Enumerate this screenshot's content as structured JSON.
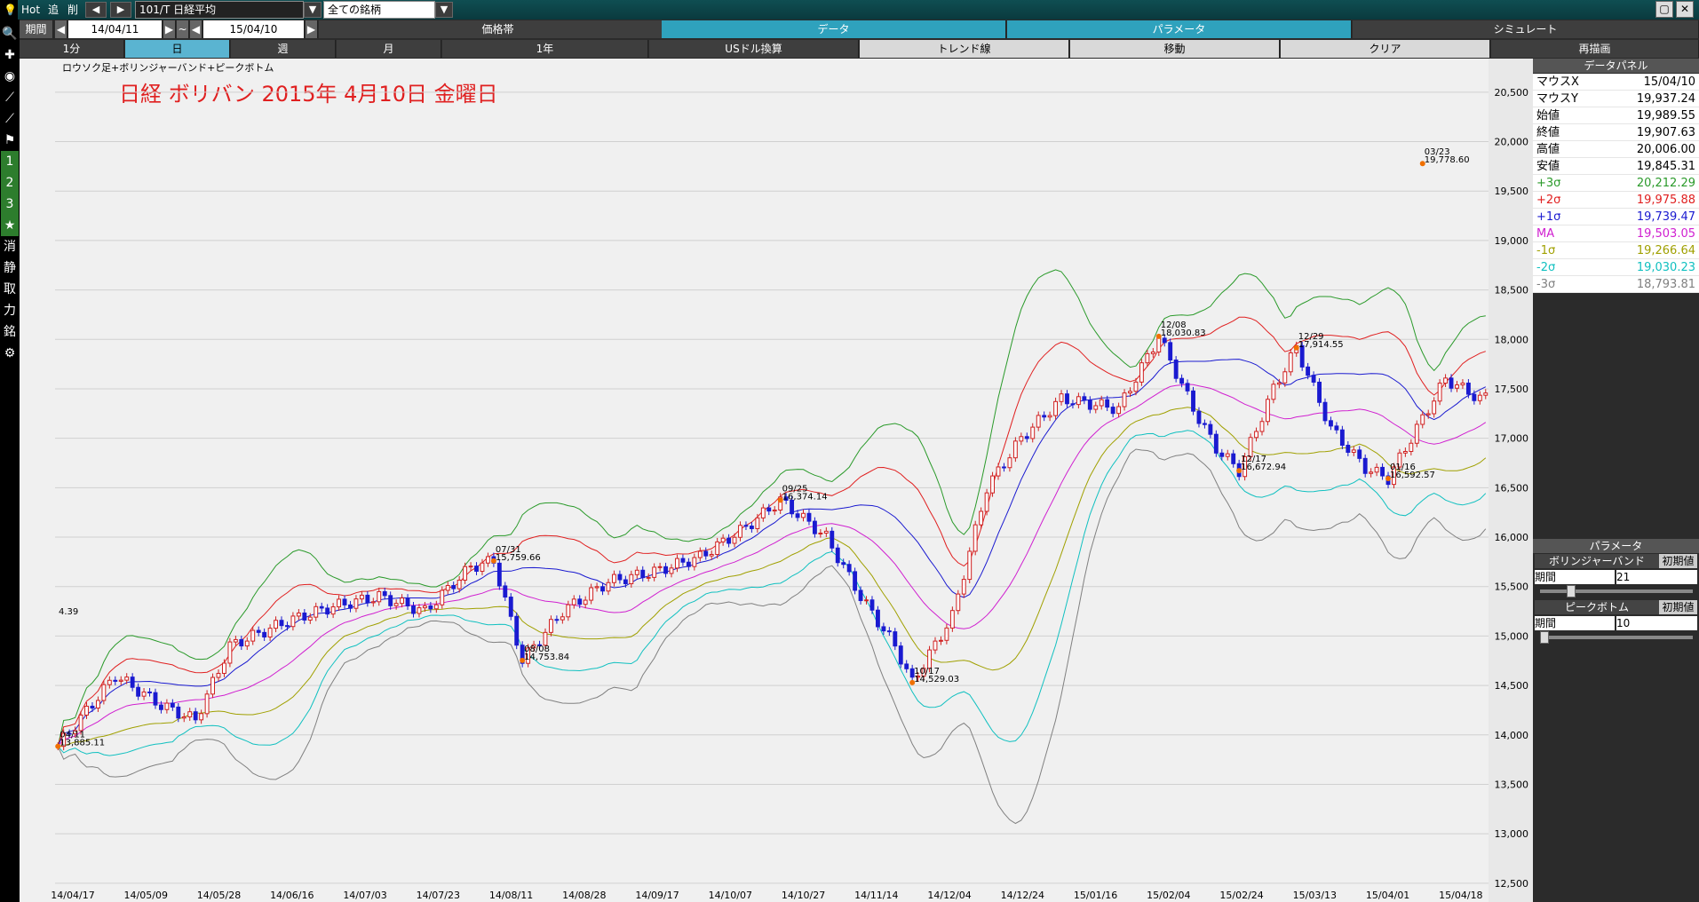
{
  "topbar": {
    "hot": "Hot",
    "add": "追",
    "del": "削",
    "symbol": "101/T 日経平均",
    "group": "全ての銘柄",
    "period_label": "期間",
    "date_from": "14/04/11",
    "tilde": "~",
    "date_to": "15/04/10",
    "minimize": "▢",
    "close": "✕"
  },
  "tabs_row1": [
    {
      "label": "価格帯"
    },
    {
      "label": "データ"
    },
    {
      "label": "パラメータ"
    },
    {
      "label": "シミュレート"
    }
  ],
  "tabs_row2": [
    {
      "label": "1分"
    },
    {
      "label": "日"
    },
    {
      "label": "週"
    },
    {
      "label": "月"
    },
    {
      "label": "1年"
    },
    {
      "label": "USドル換算"
    },
    {
      "label": "トレンド線"
    },
    {
      "label": "移動"
    },
    {
      "label": "クリア"
    },
    {
      "label": "再描画"
    }
  ],
  "leftbar": {
    "items": [
      {
        "glyph": "🔍",
        "icon": "search-icon"
      },
      {
        "glyph": "✚",
        "icon": "crosshair-icon"
      },
      {
        "glyph": "◉",
        "icon": "camera-icon"
      },
      {
        "glyph": "⟋",
        "icon": "line-icon"
      },
      {
        "glyph": "⟋",
        "icon": "line2-icon"
      },
      {
        "glyph": "⚑",
        "icon": "flag-icon"
      },
      {
        "glyph": "1",
        "icon": "slot-1-icon"
      },
      {
        "glyph": "2",
        "icon": "slot-2-icon"
      },
      {
        "glyph": "3",
        "icon": "slot-3-icon"
      },
      {
        "glyph": "★",
        "icon": "star-icon"
      },
      {
        "glyph": "消",
        "icon": "erase-icon"
      },
      {
        "glyph": "静",
        "icon": "static-icon"
      },
      {
        "glyph": "取",
        "icon": "take-icon"
      },
      {
        "glyph": "力",
        "icon": "power-icon"
      },
      {
        "glyph": "銘",
        "icon": "stock-icon"
      },
      {
        "glyph": "⚙",
        "icon": "gear-icon"
      }
    ]
  },
  "chart": {
    "subtitle": "ロウソク足+ボリンジャーバンド+ピークボトム",
    "title": "日経 ボリバン 2015年 4月10日 金曜日",
    "edge_label": "4.39"
  },
  "chart_data": {
    "type": "line",
    "y_ticks": [
      "12,500",
      "13,000",
      "13,500",
      "14,000",
      "14,500",
      "15,000",
      "15,500",
      "16,000",
      "16,500",
      "17,000",
      "17,500",
      "18,000",
      "18,500",
      "19,000",
      "19,500",
      "20,000",
      "20,500"
    ],
    "ylim": [
      12400,
      20750
    ],
    "x_labels": [
      "14/04/17",
      "14/05/09",
      "14/05/28",
      "14/06/16",
      "14/07/03",
      "14/07/23",
      "14/08/11",
      "14/08/28",
      "14/09/17",
      "14/10/07",
      "14/10/27",
      "14/11/14",
      "14/12/04",
      "14/12/24",
      "15/01/16",
      "15/02/04",
      "15/02/24",
      "15/03/13",
      "15/04/01",
      "15/04/18"
    ],
    "x_count": 250,
    "close_anchors": [
      [
        0,
        13885
      ],
      [
        10,
        14600
      ],
      [
        18,
        14300
      ],
      [
        24,
        14150
      ],
      [
        30,
        14900
      ],
      [
        40,
        15150
      ],
      [
        48,
        15300
      ],
      [
        56,
        15400
      ],
      [
        64,
        15250
      ],
      [
        72,
        15700
      ],
      [
        76,
        15760
      ],
      [
        81,
        14754
      ],
      [
        88,
        15250
      ],
      [
        96,
        15550
      ],
      [
        104,
        15650
      ],
      [
        112,
        15800
      ],
      [
        120,
        16100
      ],
      [
        126,
        16374
      ],
      [
        134,
        16000
      ],
      [
        140,
        15400
      ],
      [
        146,
        14900
      ],
      [
        149,
        14529
      ],
      [
        156,
        15200
      ],
      [
        162,
        16500
      ],
      [
        168,
        17000
      ],
      [
        175,
        17400
      ],
      [
        185,
        17300
      ],
      [
        192,
        18031
      ],
      [
        198,
        17300
      ],
      [
        202,
        16900
      ],
      [
        206,
        16673
      ],
      [
        212,
        17500
      ],
      [
        216,
        17915
      ],
      [
        222,
        17100
      ],
      [
        228,
        16700
      ],
      [
        232,
        16593
      ],
      [
        238,
        17200
      ],
      [
        242,
        17600
      ],
      [
        248,
        17400
      ]
    ],
    "bands": [
      {
        "name": "+3σ",
        "color": "#2a9a2a"
      },
      {
        "name": "+2σ",
        "color": "#e02020"
      },
      {
        "name": "+1σ",
        "color": "#1a1ad0"
      },
      {
        "name": "MA",
        "color": "#d020d0"
      },
      {
        "name": "-1σ",
        "color": "#a0a000"
      },
      {
        "name": "-2σ",
        "color": "#10c0c0"
      },
      {
        "name": "-3σ",
        "color": "#808080"
      }
    ],
    "peaks": [
      {
        "date": "04/11",
        "value": "13,885.11"
      },
      {
        "date": "07/31",
        "value": "15,759.66"
      },
      {
        "date": "08/08",
        "value": "14,753.84"
      },
      {
        "date": "09/25",
        "value": "16,374.14"
      },
      {
        "date": "10/17",
        "value": "14,529.03"
      },
      {
        "date": "12/08",
        "value": "18,030.83"
      },
      {
        "date": "12/17",
        "value": "16,672.94"
      },
      {
        "date": "12/29",
        "value": "17,914.55"
      },
      {
        "date": "01/16",
        "value": "16,592.57"
      },
      {
        "date": "03/23",
        "value": "19,778.60"
      }
    ]
  },
  "panel": {
    "title": "データパネル",
    "rows": [
      {
        "label": "マウスX",
        "value": "15/04/10",
        "color": "#000000"
      },
      {
        "label": "マウスY",
        "value": "19,937.24",
        "color": "#000000"
      },
      {
        "label": "始値",
        "value": "19,989.55",
        "color": "#000000"
      },
      {
        "label": "終値",
        "value": "19,907.63",
        "color": "#000000"
      },
      {
        "label": "高値",
        "value": "20,006.00",
        "color": "#000000"
      },
      {
        "label": "安値",
        "value": "19,845.31",
        "color": "#000000"
      },
      {
        "label": "+3σ",
        "value": "20,212.29",
        "color": "#2a9a2a"
      },
      {
        "label": "+2σ",
        "value": "19,975.88",
        "color": "#e02020"
      },
      {
        "label": "+1σ",
        "value": "19,739.47",
        "color": "#1a1ad0"
      },
      {
        "label": "MA",
        "value": "19,503.05",
        "color": "#d020d0"
      },
      {
        "label": "-1σ",
        "value": "19,266.64",
        "color": "#a0a000"
      },
      {
        "label": "-2σ",
        "value": "19,030.23",
        "color": "#10c0c0"
      },
      {
        "label": "-3σ",
        "value": "18,793.81",
        "color": "#808080"
      }
    ]
  },
  "params": {
    "title": "パラメータ",
    "bb_label": "ボリンジャーバンド",
    "bb_reset": "初期値",
    "bb_period_label": "期間",
    "bb_period": "21",
    "pb_label": "ピークボトム",
    "pb_reset": "初期値",
    "pb_period_label": "期間",
    "pb_period": "10"
  }
}
